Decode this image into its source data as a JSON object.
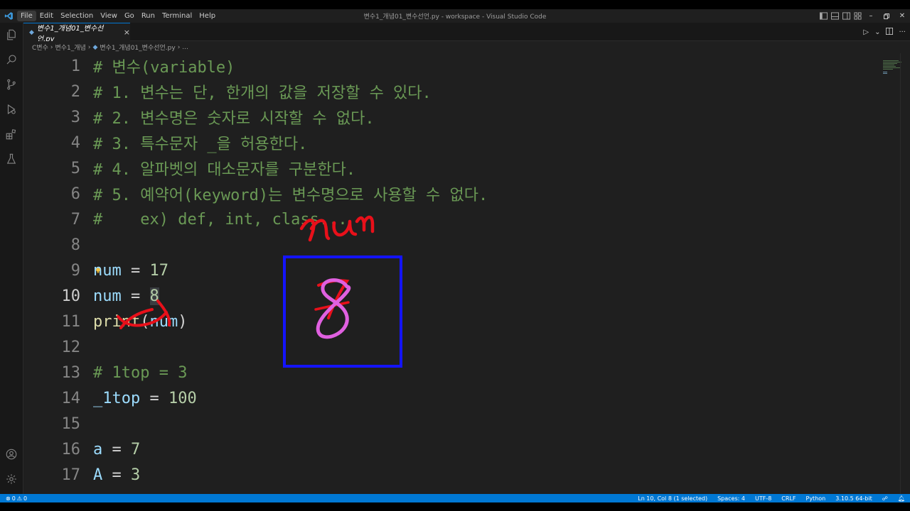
{
  "window": {
    "title": "변수1_개념01_변수선언.py - workspace - Visual Studio Code",
    "menu": [
      "File",
      "Edit",
      "Selection",
      "View",
      "Go",
      "Run",
      "Terminal",
      "Help"
    ]
  },
  "tab": {
    "label": "변수1_개념01_변수선언.py",
    "close": "×"
  },
  "breadcrumbs": {
    "folder1": "C변수",
    "folder2": "변수1_개념",
    "file": "변수1_개념01_변수선언.py",
    "more": "..."
  },
  "editor": {
    "lines": [
      {
        "n": "1",
        "text": "# 변수(variable)"
      },
      {
        "n": "2",
        "text": "# 1. 변수는 단, 한개의 값을 저장할 수 있다."
      },
      {
        "n": "3",
        "text": "# 2. 변수명은 숫자로 시작할 수 없다."
      },
      {
        "n": "4",
        "text": "# 3. 특수문자 _을 허용한다."
      },
      {
        "n": "5",
        "text": "# 4. 알파벳의 대소문자를 구분한다."
      },
      {
        "n": "6",
        "text": "# 5. 예약어(keyword)는 변수명으로 사용할 수 없다."
      },
      {
        "n": "7",
        "text": "#    ex) def, int, class..."
      },
      {
        "n": "8",
        "text": ""
      },
      {
        "n": "9",
        "var": "num",
        "op": " = ",
        "val": "17"
      },
      {
        "n": "10",
        "var": "num",
        "op": " = ",
        "val": "8"
      },
      {
        "n": "11",
        "fn": "print",
        "open": "(",
        "arg": "num",
        "close": ")"
      },
      {
        "n": "12",
        "text": ""
      },
      {
        "n": "13",
        "text": "# 1top = 3"
      },
      {
        "n": "14",
        "var": "_1top",
        "op": " = ",
        "val": "100"
      },
      {
        "n": "15",
        "text": ""
      },
      {
        "n": "16",
        "var": "a",
        "op": " = ",
        "val": "7"
      },
      {
        "n": "17",
        "var": "A",
        "op": " = ",
        "val": "3"
      }
    ]
  },
  "annotations": {
    "box_label": "num",
    "box_value": "8",
    "colors": {
      "red": "#e8101a",
      "blue": "#1414ff",
      "pink": "#e060e0"
    }
  },
  "statusbar": {
    "errors": "0",
    "warnings": "0",
    "position": "Ln 10, Col 8 (1 selected)",
    "spaces": "Spaces: 4",
    "encoding": "UTF-8",
    "eol": "CRLF",
    "language": "Python",
    "interpreter": "3.10.5 64-bit"
  },
  "colors": {
    "accent": "#0078d4",
    "comment": "#6a9955",
    "variable": "#9cdcfe",
    "number": "#b5cea8",
    "function": "#dcdcaa"
  }
}
